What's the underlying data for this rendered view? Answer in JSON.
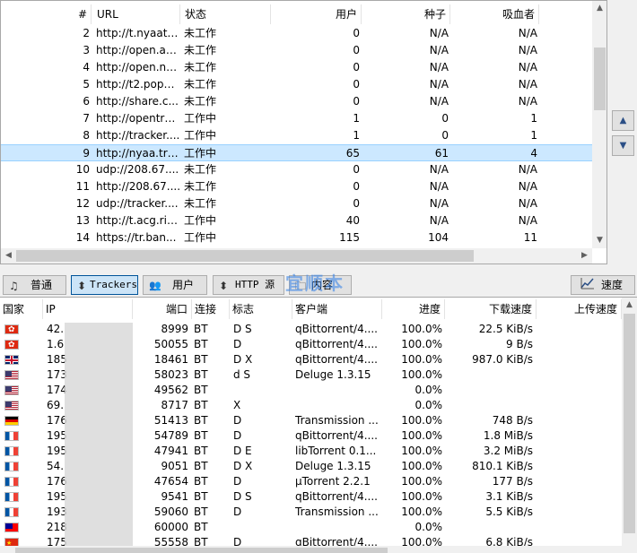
{
  "trackers": {
    "columns": {
      "num": "#",
      "url": "URL",
      "status": "状态",
      "users": "用户",
      "seeds": "种子",
      "leechers": "吸血者"
    },
    "rows": [
      {
        "num": "2",
        "url": "http://t.nyaatr...",
        "status": "未工作",
        "users": "0",
        "seeds": "N/A",
        "leechers": "N/A"
      },
      {
        "num": "3",
        "url": "http://open.ac...",
        "status": "未工作",
        "users": "0",
        "seeds": "N/A",
        "leechers": "N/A"
      },
      {
        "num": "4",
        "url": "http://open.ny...",
        "status": "未工作",
        "users": "0",
        "seeds": "N/A",
        "leechers": "N/A"
      },
      {
        "num": "5",
        "url": "http://t2.popg...",
        "status": "未工作",
        "users": "0",
        "seeds": "N/A",
        "leechers": "N/A"
      },
      {
        "num": "6",
        "url": "http://share.c...",
        "status": "未工作",
        "users": "0",
        "seeds": "N/A",
        "leechers": "N/A"
      },
      {
        "num": "7",
        "url": "http://opentra...",
        "status": "工作中",
        "users": "1",
        "seeds": "0",
        "leechers": "1"
      },
      {
        "num": "8",
        "url": "http://tracker....",
        "status": "工作中",
        "users": "1",
        "seeds": "0",
        "leechers": "1"
      },
      {
        "num": "9",
        "url": "http://nyaa.tra...",
        "status": "工作中",
        "users": "65",
        "seeds": "61",
        "leechers": "4"
      },
      {
        "num": "10",
        "url": "udp://208.67....",
        "status": "未工作",
        "users": "0",
        "seeds": "N/A",
        "leechers": "N/A"
      },
      {
        "num": "11",
        "url": "http://208.67....",
        "status": "未工作",
        "users": "0",
        "seeds": "N/A",
        "leechers": "N/A"
      },
      {
        "num": "12",
        "url": "udp://tracker....",
        "status": "未工作",
        "users": "0",
        "seeds": "N/A",
        "leechers": "N/A"
      },
      {
        "num": "13",
        "url": "http://t.acg.rip...",
        "status": "工作中",
        "users": "40",
        "seeds": "N/A",
        "leechers": "N/A"
      },
      {
        "num": "14",
        "url": "https://tr.ban...",
        "status": "工作中",
        "users": "115",
        "seeds": "104",
        "leechers": "11"
      }
    ],
    "selected_index": 7
  },
  "side_buttons": {
    "up_icon": "▲",
    "down_icon": "▼"
  },
  "tabs": [
    {
      "label": "普通",
      "icon": "♫",
      "icon_name": "general-icon",
      "active": false
    },
    {
      "label": "Trackers",
      "icon": "⬍",
      "icon_name": "trackers-icon",
      "active": true
    },
    {
      "label": "用户",
      "icon": "👥",
      "icon_name": "peers-icon",
      "active": false
    },
    {
      "label": "HTTP 源",
      "icon": "⬍",
      "icon_name": "http-sources-icon",
      "active": false
    },
    {
      "label": "内容",
      "icon": "🗀",
      "icon_name": "content-icon",
      "active": false
    }
  ],
  "speed_button": {
    "label": "速度",
    "icon_name": "chart-icon"
  },
  "watermark": "宜顺本",
  "peers": {
    "columns": {
      "country": "国家",
      "ip": "IP",
      "port": "端口",
      "conn": "连接",
      "flags": "标志",
      "client": "客户端",
      "progress": "进度",
      "dl": "下载速度",
      "ul": "上传速度"
    },
    "rows": [
      {
        "flag": "hk",
        "ip": "42.",
        "port": "8999",
        "conn": "BT",
        "flags": "D S",
        "client": "qBittorrent/4....",
        "progress": "100.0%",
        "dl": "22.5 KiB/s",
        "ul": ""
      },
      {
        "flag": "hk",
        "ip": "1.6",
        "port": "50055",
        "conn": "BT",
        "flags": "D",
        "client": "qBittorrent/4....",
        "progress": "100.0%",
        "dl": "9 B/s",
        "ul": ""
      },
      {
        "flag": "gb",
        "ip": "185",
        "port": "18461",
        "conn": "BT",
        "flags": "D X",
        "client": "qBittorrent/4....",
        "progress": "100.0%",
        "dl": "987.0 KiB/s",
        "ul": ""
      },
      {
        "flag": "us",
        "ip": "173",
        "port": "58023",
        "conn": "BT",
        "flags": "d S",
        "client": "Deluge 1.3.15",
        "progress": "100.0%",
        "dl": "",
        "ul": ""
      },
      {
        "flag": "us",
        "ip": "174",
        "port": "49562",
        "conn": "BT",
        "flags": "",
        "client": "",
        "progress": "0.0%",
        "dl": "",
        "ul": ""
      },
      {
        "flag": "us",
        "ip": "69.",
        "port": "8717",
        "conn": "BT",
        "flags": "X",
        "client": "",
        "progress": "0.0%",
        "dl": "",
        "ul": ""
      },
      {
        "flag": "de",
        "ip": "176",
        "port": "51413",
        "conn": "BT",
        "flags": "D",
        "client": "Transmission ...",
        "progress": "100.0%",
        "dl": "748 B/s",
        "ul": ""
      },
      {
        "flag": "fr",
        "ip": "195",
        "port": "54789",
        "conn": "BT",
        "flags": "D",
        "client": "qBittorrent/4....",
        "progress": "100.0%",
        "dl": "1.8 MiB/s",
        "ul": ""
      },
      {
        "flag": "fr",
        "ip": "195",
        "port": "47941",
        "conn": "BT",
        "flags": "D E",
        "client": "libTorrent 0.1...",
        "progress": "100.0%",
        "dl": "3.2 MiB/s",
        "ul": ""
      },
      {
        "flag": "fr",
        "ip": "54.",
        "port": "9051",
        "conn": "BT",
        "flags": "D X",
        "client": "Deluge 1.3.15",
        "progress": "100.0%",
        "dl": "810.1 KiB/s",
        "ul": ""
      },
      {
        "flag": "fr",
        "ip": "176",
        "port": "47654",
        "conn": "BT",
        "flags": "D",
        "client": "µTorrent 2.2.1",
        "progress": "100.0%",
        "dl": "177 B/s",
        "ul": ""
      },
      {
        "flag": "fr",
        "ip": "195",
        "port": "9541",
        "conn": "BT",
        "flags": "D S",
        "client": "qBittorrent/4....",
        "progress": "100.0%",
        "dl": "3.1 KiB/s",
        "ul": ""
      },
      {
        "flag": "fr",
        "ip": "193",
        "port": "59060",
        "conn": "BT",
        "flags": "D",
        "client": "Transmission ...",
        "progress": "100.0%",
        "dl": "5.5 KiB/s",
        "ul": ""
      },
      {
        "flag": "tw",
        "ip": "218",
        "port": "60000",
        "conn": "BT",
        "flags": "",
        "client": "",
        "progress": "0.0%",
        "dl": "",
        "ul": ""
      },
      {
        "flag": "cn",
        "ip": "175",
        "port": "55558",
        "conn": "BT",
        "flags": "D",
        "client": "qBittorrent/4....",
        "progress": "100.0%",
        "dl": "6.8 KiB/s",
        "ul": ""
      }
    ]
  }
}
